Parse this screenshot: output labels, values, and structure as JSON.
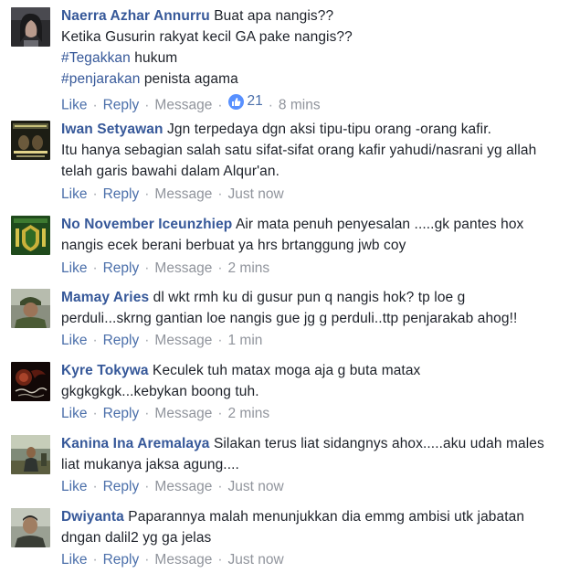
{
  "actions": {
    "like": "Like",
    "reply": "Reply",
    "message": "Message",
    "separator": "·"
  },
  "comments": [
    {
      "author": "Naerra Azhar Annurru",
      "lines": [
        "Buat apa nangis??",
        "Ketika Gusurin rakyat kecil GA pake nangis??",
        "",
        ""
      ],
      "tag1": "#Tegakkan",
      "tag1_rest": " hukum",
      "tag2": "#penjarakan",
      "tag2_rest": " penista agama",
      "likes": "21",
      "time": "8 mins",
      "avatar": "woman-portrait"
    },
    {
      "author": "Iwan Setyawan",
      "lines": [
        "Jgn terpedaya dgn aksi tipu-tipu orang -orang kafir.",
        "Itu hanya sebagian salah satu sifat-sifat orang kafir yahudi/nasrani yg allah",
        "telah garis bawahi dalam Alqur'an."
      ],
      "time": "Just now",
      "avatar": "religious-poster"
    },
    {
      "author": "No November Iceunzhiep",
      "lines": [
        "Air mata penuh penyesalan .....gk pantes hox",
        "nangis ecek berani berbuat ya hrs brtanggung jwb coy"
      ],
      "time": "2 mins",
      "avatar": "green-emblem"
    },
    {
      "author": "Mamay Aries",
      "lines": [
        "dl wkt rmh ku di gusur pun q nangis hok? tp loe g",
        "perduli...skrng gantian loe nangis gue jg g perduli..ttp penjarakab ahog!!"
      ],
      "time": "1 min",
      "avatar": "soldier-photo"
    },
    {
      "author": "Kyre Tokywa",
      "lines": [
        "Keculek tuh matax moga aja g buta matax",
        "gkgkgkgk...kebykan boong tuh."
      ],
      "time": "2 mins",
      "avatar": "dark-calligraphy"
    },
    {
      "author": "Kanina Ina Aremalaya",
      "lines": [
        "Silakan terus liat sidangnys ahox.....aku udah males",
        "liat mukanya jaksa agung...."
      ],
      "time": "Just now",
      "avatar": "outdoor-scene"
    },
    {
      "author": "Dwiyanta",
      "lines": [
        "Paparannya malah menunjukkan dia emmg ambisi utk jabatan",
        "dngan dalil2 yg ga jelas"
      ],
      "time": "Just now",
      "avatar": "man-portrait"
    }
  ]
}
